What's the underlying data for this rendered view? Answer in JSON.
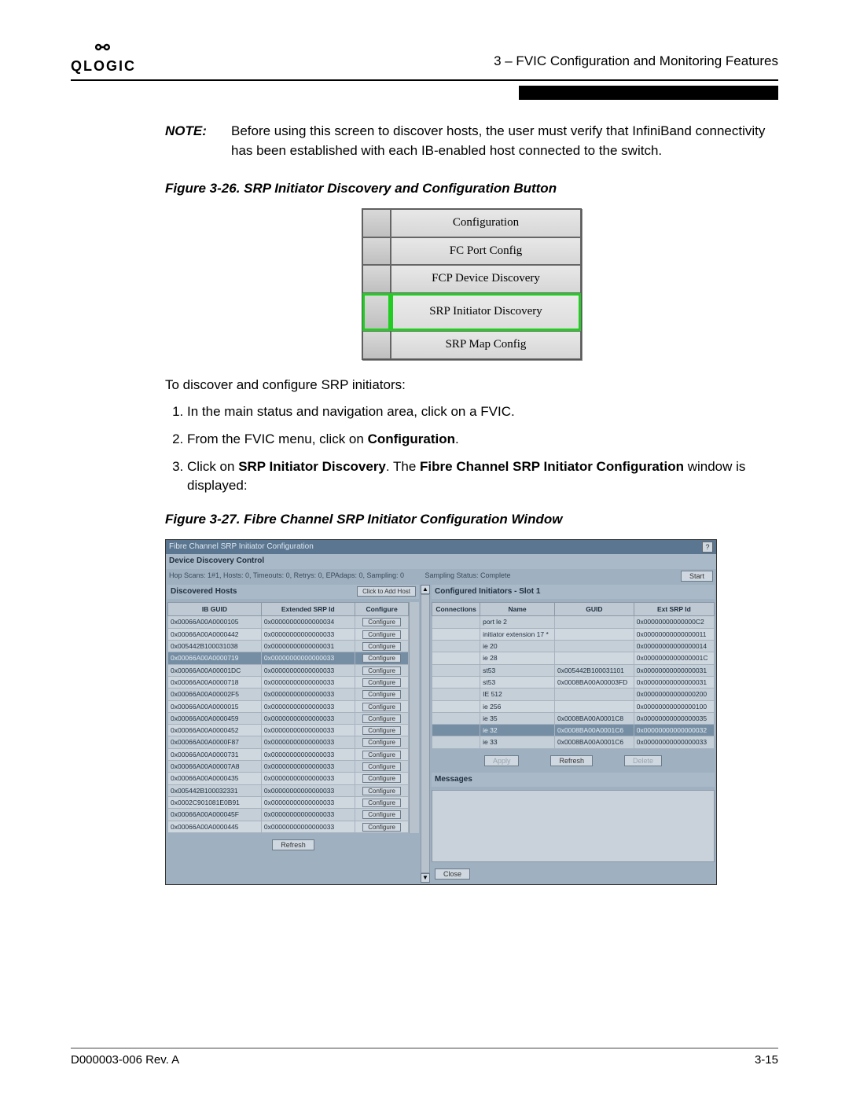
{
  "header": {
    "brand": "QLOGIC",
    "chapter": "3 – FVIC Configuration and Monitoring Features"
  },
  "note": {
    "label": "NOTE:",
    "body": "Before using this screen to discover hosts, the user must verify that InfiniBand connectivity has been established with each IB-enabled host connected to the switch."
  },
  "fig26": {
    "caption": "Figure 3-26. SRP Initiator Discovery and Configuration Button",
    "items": [
      "Configuration",
      "FC Port Config",
      "FCP Device Discovery",
      "SRP Initiator Discovery",
      "SRP Map Config"
    ]
  },
  "intro": "To discover and configure SRP initiators:",
  "steps": {
    "s1": "In the main status and navigation area, click on a FVIC.",
    "s2a": "From the FVIC menu, click on ",
    "s2b": "Configuration",
    "s2c": ".",
    "s3a": "Click on ",
    "s3b": "SRP Initiator Discovery",
    "s3c": ". The ",
    "s3d": "Fibre Channel SRP Initiator Configuration",
    "s3e": " window is displayed:"
  },
  "fig27": {
    "caption": "Figure 3-27. Fibre Channel SRP Initiator Configuration Window",
    "window_title": "Fibre Channel SRP Initiator Configuration",
    "ddc_title": "Device Discovery Control",
    "status1": "Hop Scans: 1#1, Hosts: 0, Timeouts: 0, Retrys: 0, EPAdaps: 0, Sampling: 0",
    "status2": "Sampling Status: Complete",
    "btn_start": "Start",
    "discovered_hosts_title": "Discovered Hosts",
    "btn_add_host": "Click to Add Host",
    "col_ibguid": "IB GUID",
    "col_ext": "Extended SRP Id",
    "col_cfg": "Configure",
    "btn_configure": "Configure",
    "btn_refresh": "Refresh",
    "configured_title": "Configured Initiators - Slot 1",
    "col_conn": "Connections",
    "col_name": "Name",
    "col_guid": "GUID",
    "col_extsrp": "Ext SRP Id",
    "btn_apply": "Apply",
    "btn_delete": "Delete",
    "messages_title": "Messages",
    "btn_close": "Close",
    "hosts": [
      {
        "guid": "0x00066A00A0000105",
        "ext": "0x00000000000000034"
      },
      {
        "guid": "0x00066A00A0000442",
        "ext": "0x00000000000000033"
      },
      {
        "guid": "0x005442B100031038",
        "ext": "0x00000000000000031"
      },
      {
        "guid": "0x00066A00A0000719",
        "ext": "0x00000000000000033"
      },
      {
        "guid": "0x00066A00A00001DC",
        "ext": "0x00000000000000033"
      },
      {
        "guid": "0x00066A00A0000718",
        "ext": "0x00000000000000033"
      },
      {
        "guid": "0x00066A00A00002F5",
        "ext": "0x00000000000000033"
      },
      {
        "guid": "0x00066A00A0000015",
        "ext": "0x00000000000000033"
      },
      {
        "guid": "0x00066A00A0000459",
        "ext": "0x00000000000000033"
      },
      {
        "guid": "0x00066A00A0000452",
        "ext": "0x00000000000000033"
      },
      {
        "guid": "0x00066A00A0000F87",
        "ext": "0x00000000000000033"
      },
      {
        "guid": "0x00066A00A0000731",
        "ext": "0x00000000000000033"
      },
      {
        "guid": "0x00066A00A00007A8",
        "ext": "0x00000000000000033"
      },
      {
        "guid": "0x00066A00A0000435",
        "ext": "0x00000000000000033"
      },
      {
        "guid": "0x005442B100032331",
        "ext": "0x00000000000000033"
      },
      {
        "guid": "0x0002C901081E0B91",
        "ext": "0x00000000000000033"
      },
      {
        "guid": "0x00066A00A000045F",
        "ext": "0x00000000000000033"
      },
      {
        "guid": "0x00066A00A0000445",
        "ext": "0x00000000000000033"
      }
    ],
    "inits": [
      {
        "conn": "",
        "name": "port le 2",
        "guid": "",
        "ext": "0x00000000000000C2"
      },
      {
        "conn": "",
        "name": "initiator extension 17 *",
        "guid": "",
        "ext": "0x00000000000000011"
      },
      {
        "conn": "",
        "name": "ie 20",
        "guid": "",
        "ext": "0x00000000000000014"
      },
      {
        "conn": "",
        "name": "ie 28",
        "guid": "",
        "ext": "0x0000000000000001C"
      },
      {
        "conn": "",
        "name": "st53",
        "guid": "0x005442B100031101",
        "ext": "0x00000000000000031"
      },
      {
        "conn": "",
        "name": "st53",
        "guid": "0x0008BA00A00003FD",
        "ext": "0x00000000000000031"
      },
      {
        "conn": "",
        "name": "IE 512",
        "guid": "",
        "ext": "0x00000000000000200"
      },
      {
        "conn": "",
        "name": "ie 256",
        "guid": "",
        "ext": "0x00000000000000100"
      },
      {
        "conn": "",
        "name": "ie 35",
        "guid": "0x0008BA00A0001C8",
        "ext": "0x00000000000000035"
      },
      {
        "conn": "",
        "name": "ie 32",
        "guid": "0x0008BA00A0001C6",
        "ext": "0x00000000000000032"
      },
      {
        "conn": "",
        "name": "ie 33",
        "guid": "0x0008BA00A0001C6",
        "ext": "0x00000000000000033"
      }
    ]
  },
  "footer": {
    "left": "D000003-006 Rev. A",
    "right": "3-15"
  }
}
